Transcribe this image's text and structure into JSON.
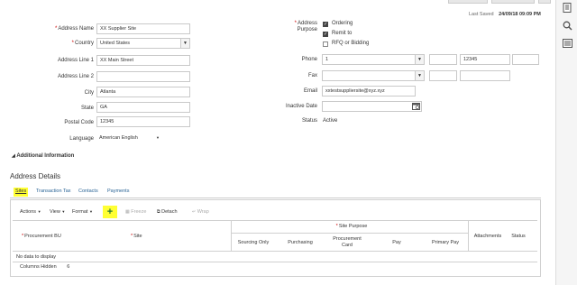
{
  "header": {
    "last_saved_label": "Last Saved",
    "last_saved_value": "24/09/18 09:09 PM"
  },
  "form_left": {
    "address_name": {
      "label": "Address Name",
      "value": "XX Supplier Site",
      "required": true
    },
    "country": {
      "label": "Country",
      "value": "United States",
      "required": true
    },
    "address_line1": {
      "label": "Address Line 1",
      "value": "XX Main Street"
    },
    "address_line2": {
      "label": "Address Line 2",
      "value": ""
    },
    "city": {
      "label": "City",
      "value": "Atlanta"
    },
    "state": {
      "label": "State",
      "value": "GA"
    },
    "postal_code": {
      "label": "Postal Code",
      "value": "12345"
    },
    "language": {
      "label": "Language",
      "value": "American English"
    }
  },
  "form_right": {
    "address_purpose": {
      "label_line1": "Address",
      "label_line2": "Purpose",
      "options": [
        {
          "label": "Ordering",
          "checked": true
        },
        {
          "label": "Remit to",
          "checked": true
        },
        {
          "label": "RFQ or Bidding",
          "checked": false
        }
      ]
    },
    "phone": {
      "label": "Phone",
      "country_code": "1",
      "number": "12345"
    },
    "fax": {
      "label": "Fax"
    },
    "email": {
      "label": "Email",
      "value": "xxtestsuppliersite@xyz.xyz"
    },
    "inactive_date": {
      "label": "Inactive Date",
      "value": ""
    },
    "status": {
      "label": "Status",
      "value": "Active"
    }
  },
  "additional_info": {
    "label": "Additional Information"
  },
  "address_details": {
    "title": "Address Details",
    "tabs": [
      "Sites",
      "Transaction Tax",
      "Contacts",
      "Payments"
    ],
    "toolbar": {
      "actions": "Actions",
      "view": "View",
      "format": "Format",
      "add": "+",
      "freeze": "Freeze",
      "detach": "Detach",
      "wrap": "Wrap"
    },
    "table": {
      "col_procurement_bu": "Procurement BU",
      "col_site": "Site",
      "site_purpose_group": "Site Purpose",
      "col_sourcing_only": "Sourcing Only",
      "col_purchasing": "Purchasing",
      "col_procurement_card_l1": "Procurement",
      "col_procurement_card_l2": "Card",
      "col_pay": "Pay",
      "col_primary_pay": "Primary Pay",
      "col_attachments": "Attachments",
      "col_status": "Status",
      "empty_text": "No data to display",
      "columns_hidden_label": "Columns Hidden",
      "columns_hidden_value": "6"
    }
  },
  "colors": {
    "highlight": "#ffff33",
    "link": "#2a6496",
    "required": "#cc0000"
  }
}
